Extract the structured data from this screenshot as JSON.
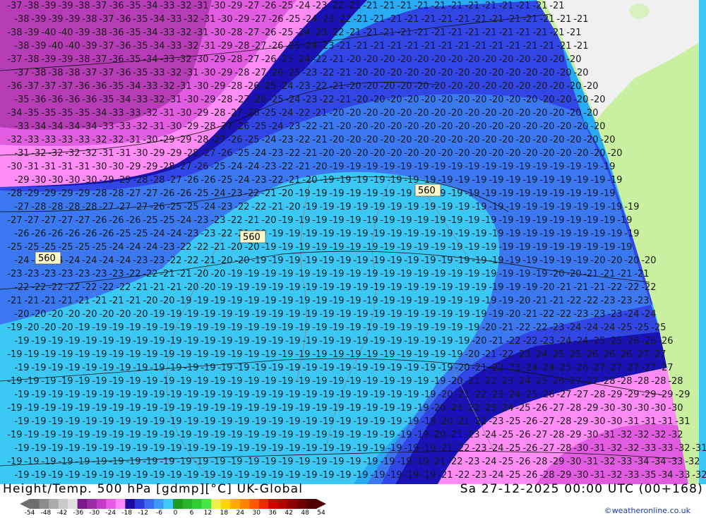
{
  "title": {
    "left": "Height/Temp. 500 hPa [gdmp][°C] UK-Global",
    "right": "Sa 27-12-2025 00:00 UTC (00+168)"
  },
  "credit": "©weatheronline.co.uk",
  "colorbar": {
    "ticks": [
      "-54",
      "-48",
      "-42",
      "-36",
      "-30",
      "-24",
      "-18",
      "-12",
      "-6",
      "0",
      "6",
      "12",
      "18",
      "24",
      "30",
      "36",
      "42",
      "48",
      "54"
    ],
    "colors": [
      "#6e6e6e",
      "#8c8c8c",
      "#aaaaaa",
      "#c8c8c8",
      "#e0e0e0",
      "#7a1a8a",
      "#9a2aa8",
      "#c23ac8",
      "#e85ae8",
      "#ff88ff",
      "#1a0aa0",
      "#2a3ad8",
      "#3a6af0",
      "#3a9af8",
      "#40c8f8",
      "#1e9a1e",
      "#28b428",
      "#32cc32",
      "#46e646",
      "#f0f046",
      "#ffd400",
      "#ffaa00",
      "#ff8400",
      "#ff5a00",
      "#f02800",
      "#d20000",
      "#b40000",
      "#8c0000",
      "#6e0000",
      "#500000"
    ]
  },
  "map": {
    "height_labels": [
      "560",
      "560",
      "560"
    ],
    "colors": {
      "magenta_dark": "#b53cb5",
      "magenta": "#e25ce2",
      "pink": "#ff8cf5",
      "navy": "#1a12b4",
      "blue": "#3246e6",
      "mid_blue": "#3c78f0",
      "light_blue": "#28aaf5",
      "cyan": "#3cc8f5",
      "land_green": "#c8f0a0",
      "land_gray": "#f0f0f0"
    }
  }
}
